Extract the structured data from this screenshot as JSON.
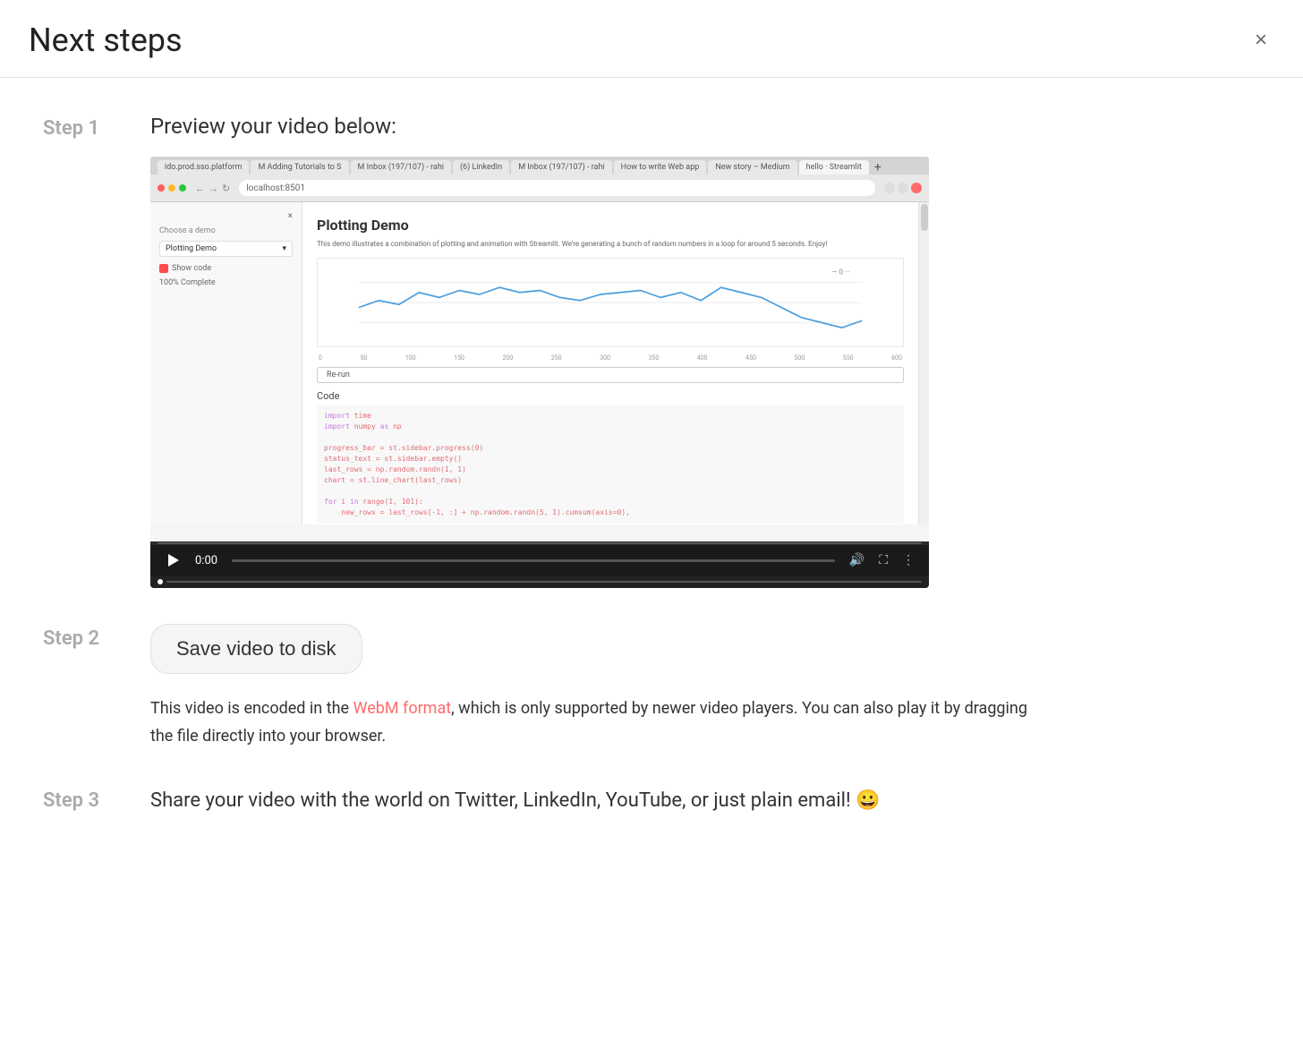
{
  "header": {
    "title": "Next steps",
    "close_label": "×"
  },
  "step1": {
    "label": "Step 1",
    "title": "Preview your video below:",
    "browser": {
      "url": "localhost:8501",
      "tabs": [
        {
          "label": "ido.prod.sso.platform",
          "active": false
        },
        {
          "label": "M Adding Tutorials to S",
          "active": false
        },
        {
          "label": "M Inbox (197/107) - rahi",
          "active": false
        },
        {
          "label": "(6) LinkedIn",
          "active": false
        },
        {
          "label": "M Inbox (197/107) - rahi",
          "active": false
        },
        {
          "label": "How to write Web app",
          "active": false
        },
        {
          "label": "New story – Medium",
          "active": false
        },
        {
          "label": "hello · Streamlit",
          "active": true
        }
      ],
      "sidebar": {
        "choose_demo_label": "Choose a demo",
        "dropdown_value": "Plotting Demo",
        "show_code_label": "Show code",
        "progress_label": "100% Complete"
      },
      "main": {
        "demo_title": "Plotting Demo",
        "demo_description": "This demo illustrates a combination of plotting and animation with Streamlit. We're generating a bunch of random numbers in a loop for around 5 seconds. Enjoy!",
        "rerun_label": "Re-run",
        "code_label": "Code",
        "code_lines": [
          "import time",
          "import numpy as np",
          "",
          "progress_bar = st.sidebar.progress(0)",
          "status_text = st.sidebar.empty()",
          "last_rows = np.random.randn(1, 1)",
          "chart = st.line_chart(last_rows)",
          "",
          "for i in range(1, 101):",
          "    new_rows = last_rows[-1, :] + np.random.randn(5, 1).cumsum(axis=0),"
        ]
      }
    },
    "video_controls": {
      "time": "0:00"
    }
  },
  "step2": {
    "label": "Step 2",
    "button_label": "Save video to disk",
    "description_before_link": "This video is encoded in the ",
    "link_text": "WebM format",
    "description_after_link": ", which is only supported by newer video players. You can also play it by dragging the file directly into your browser."
  },
  "step3": {
    "label": "Step 3",
    "text": "Share your video with the world on Twitter, LinkedIn, YouTube, or just plain email! 😀"
  }
}
